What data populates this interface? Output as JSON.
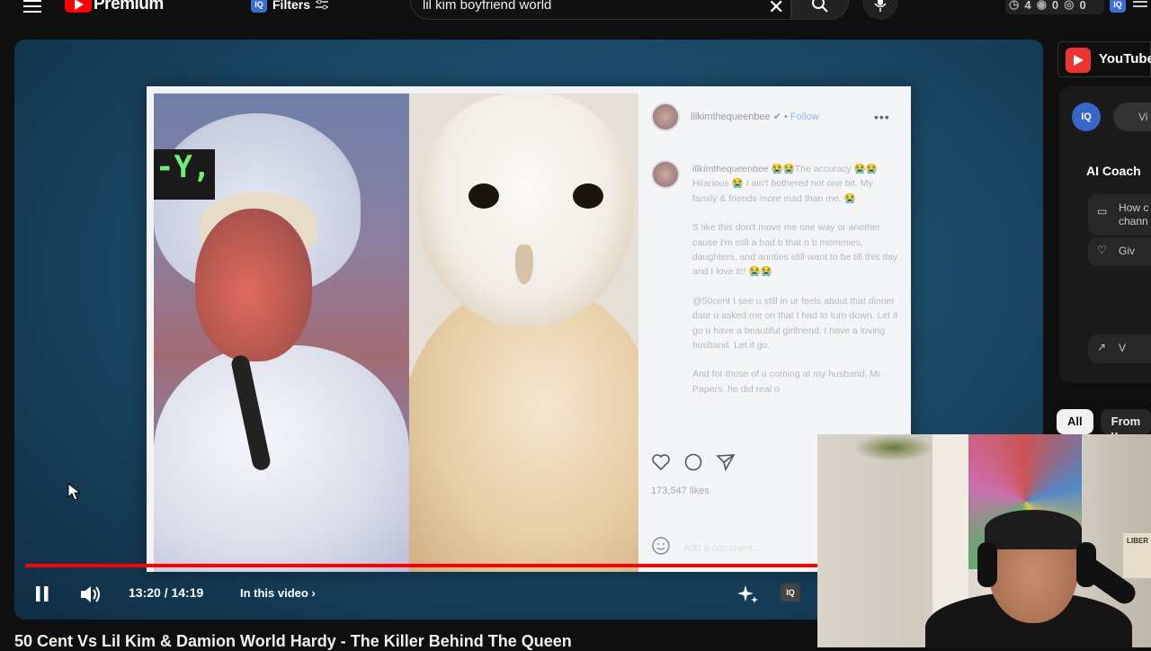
{
  "header": {
    "brand": "Premium",
    "filters_label": "Filters",
    "iq_badge": "IQ",
    "search_value": "lil kim boyfriend world",
    "stats": {
      "views_a": "4",
      "views_b": "0",
      "views_c": "0"
    }
  },
  "player": {
    "current_time": "13:20",
    "duration": "14:19",
    "time_display": "13:20 / 14:19",
    "chapter_label": "In this video",
    "progress_fraction": 0.93,
    "post": {
      "overlay_tag": "-Y,",
      "username": "lilkimthequeenbee",
      "follow": "Follow",
      "caption_user": "lilkimthequeenbee",
      "caption_p1": "😭😭The accuracy 😭😭 Hilarious 😭 I ain't bothered not one bit. My family & friends more mad than me. 😭",
      "caption_p2": "S    like this don't move me one way or another cause I'm still a bad b      that n      b           mommies, daughters, and aunties still want to be till this day and I love it!! 😭😭",
      "caption_p3": "@50cent I see u still in ur feels about that dinner date u asked me on that I had to turn down. Let it go u have a beautiful girlfriend. I have a loving husband. Let it go.",
      "caption_p4": "And for those of u coming at my husband, Mr. Papers, he did real o",
      "likes": "173,547 likes",
      "add_comment": "Add a comment..."
    }
  },
  "video_title": "50 Cent Vs Lil Kim & Damion World Hardy - The Killer Behind The Queen",
  "right": {
    "studio_label": "YouTube",
    "iq_label": "IQ",
    "vi_label": "Vi",
    "coach_title": "AI Coach",
    "coach_item1": "How c chann",
    "coach_item2": "Giv",
    "coach_item3": "V",
    "chips": [
      "All",
      "From y"
    ]
  },
  "webcam": {
    "sign_text": "LIBER"
  },
  "colors": {
    "accent": "#ff0000",
    "iq_blue": "#3b6fd8"
  }
}
